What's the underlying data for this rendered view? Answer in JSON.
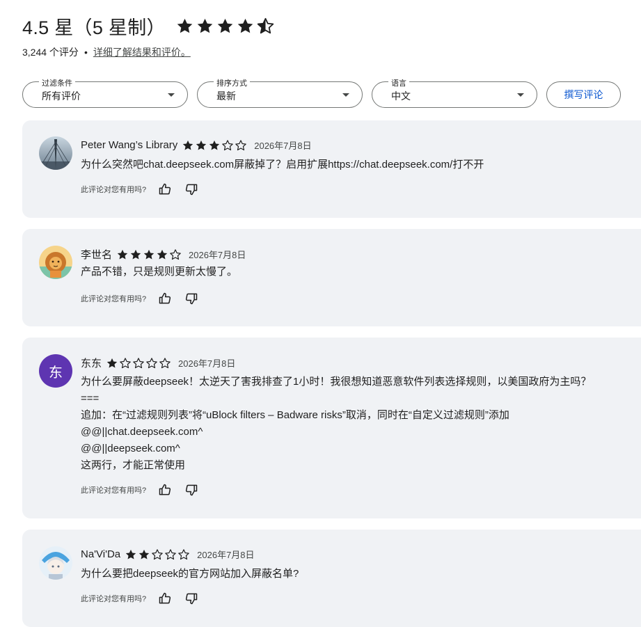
{
  "summary": {
    "rating_text": "4.5 星（5 星制）",
    "stars": 4.5,
    "count_text": "3,244 个评分",
    "separator": "•",
    "learn_more": "详细了解结果和评价。"
  },
  "filters": {
    "filter": {
      "label": "过滤条件",
      "value": "所有评价"
    },
    "sort": {
      "label": "排序方式",
      "value": "最新"
    },
    "language": {
      "label": "语言",
      "value": "中文"
    },
    "write_review": "撰写评论"
  },
  "helpful_label": "此评论对您有用吗?",
  "colors": {
    "card_bg": "#f0f2f5",
    "accent": "#0b57d0",
    "avatar_purple": "#5e35b1"
  },
  "reviews": [
    {
      "name": "Peter Wang’s Library",
      "stars": 3,
      "date": "2026年7月8日",
      "body": "为什么突然吧chat.deepseek.com屏蔽掉了？启用扩展https://chat.deepseek.com/打不开",
      "avatar": "bridge-photo"
    },
    {
      "name": "李世名",
      "stars": 4,
      "date": "2026年7月8日",
      "body": "产品不错，只是规则更新太慢了。",
      "avatar": "lion-illustration"
    },
    {
      "name": "东东",
      "stars": 1,
      "date": "2026年7月8日",
      "body": "为什么要屏蔽deepseek！太逆天了害我排查了1小时！我很想知道恶意软件列表选择规则，以美国政府为主吗？\n===\n追加：在“过滤规则列表”将“uBlock filters – Badware risks”取消，同时在“自定义过滤规则”添加\n@@||chat.deepseek.com^\n@@||deepseek.com^\n这两行，才能正常使用",
      "avatar": "letter",
      "avatar_letter": "东"
    },
    {
      "name": "Na'Vi'Da",
      "stars": 2,
      "date": "2026年7月8日",
      "body": "为什么要把deepseek的官方网站加入屏蔽名单?",
      "avatar": "anime-character"
    }
  ]
}
